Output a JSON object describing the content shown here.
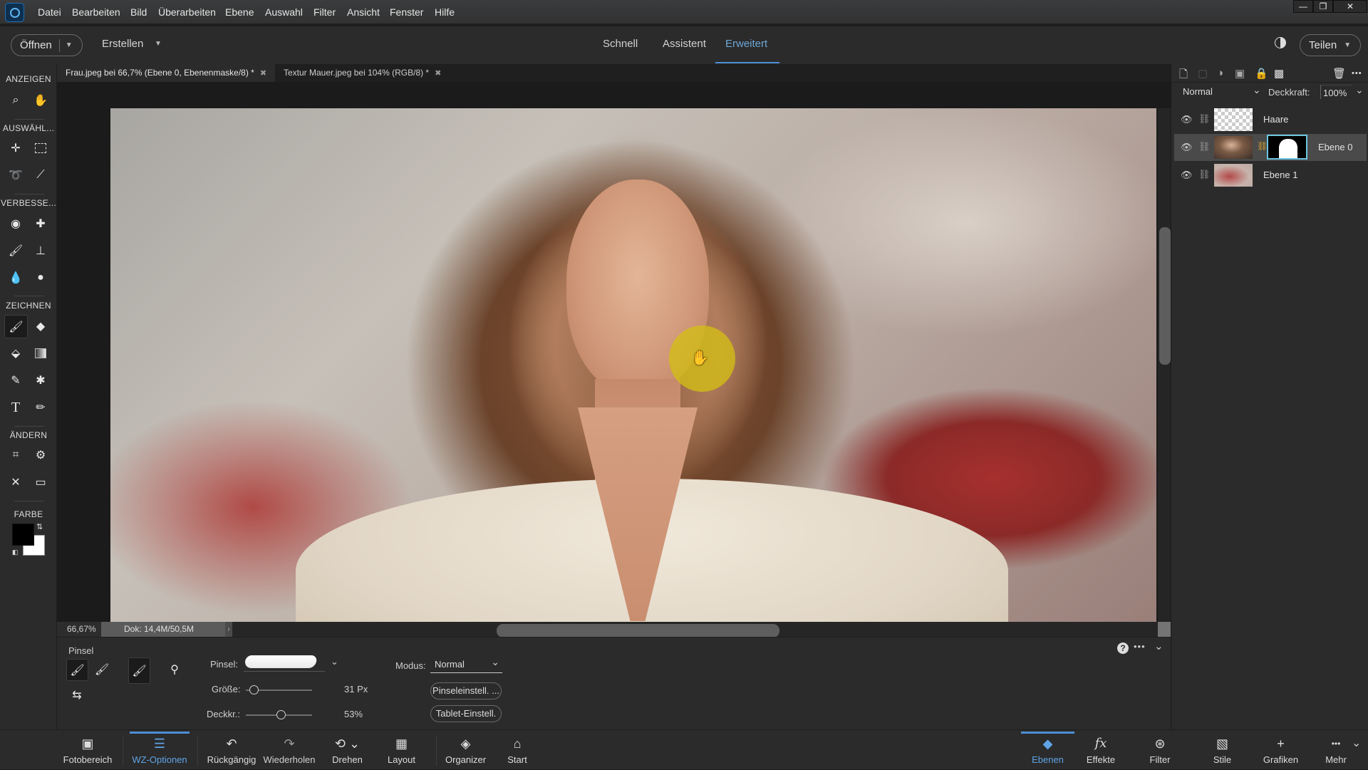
{
  "menubar": {
    "items": [
      "Datei",
      "Bearbeiten",
      "Bild",
      "Überarbeiten",
      "Ebene",
      "Auswahl",
      "Filter",
      "Ansicht",
      "Fenster",
      "Hilfe"
    ],
    "window_controls": {
      "minimize": "—",
      "restore": "❐",
      "close": "✕"
    }
  },
  "toolbar": {
    "open_label": "Öffnen",
    "create_label": "Erstellen",
    "modes": [
      {
        "label": "Schnell",
        "active": false
      },
      {
        "label": "Assistent",
        "active": false
      },
      {
        "label": "Erweitert",
        "active": true
      }
    ],
    "share_label": "Teilen",
    "theme_icon": "contrast-icon"
  },
  "document_tabs": [
    {
      "label": "Frau.jpeg bei 66,7% (Ebene 0, Ebenenmaske/8) *",
      "active": true
    },
    {
      "label": "Textur Mauer.jpeg bei 104% (RGB/8) *",
      "active": false
    }
  ],
  "tools": {
    "sections": [
      "ANZEIGEN",
      "AUSWÄHL...",
      "VERBESSE...",
      "ZEICHNEN",
      "ÄNDERN",
      "FARBE"
    ],
    "items": [
      {
        "name": "zoom-tool",
        "glyph": "🔍"
      },
      {
        "name": "hand-tool",
        "glyph": "✋"
      },
      {
        "name": "move-tool",
        "glyph": "✛"
      },
      {
        "name": "marquee-tool",
        "glyph": "⬚"
      },
      {
        "name": "lasso-tool",
        "glyph": "➰"
      },
      {
        "name": "magic-wand-tool",
        "glyph": "⁄"
      },
      {
        "name": "red-eye-tool",
        "glyph": "👁"
      },
      {
        "name": "spot-healing-tool",
        "glyph": "✚"
      },
      {
        "name": "smart-brush-tool",
        "glyph": "🖌"
      },
      {
        "name": "clone-stamp-tool",
        "glyph": "⊥"
      },
      {
        "name": "blur-tool",
        "glyph": "💧"
      },
      {
        "name": "sponge-tool",
        "glyph": "●"
      },
      {
        "name": "brush-tool",
        "glyph": "🖌",
        "active": true
      },
      {
        "name": "eraser-tool",
        "glyph": "◆"
      },
      {
        "name": "paint-bucket-tool",
        "glyph": "🪣"
      },
      {
        "name": "gradient-tool",
        "glyph": "▮"
      },
      {
        "name": "eyedropper-tool",
        "glyph": "✎"
      },
      {
        "name": "custom-shape-tool",
        "glyph": "✱"
      },
      {
        "name": "type-tool",
        "glyph": "T"
      },
      {
        "name": "pencil-tool",
        "glyph": "✏"
      },
      {
        "name": "crop-tool",
        "glyph": "⌗"
      },
      {
        "name": "recompose-tool",
        "glyph": "⚙"
      },
      {
        "name": "content-aware-move-tool",
        "glyph": "✕"
      },
      {
        "name": "straighten-tool",
        "glyph": "▭"
      }
    ],
    "foreground_color": "#000000",
    "background_color": "#ffffff"
  },
  "canvas": {
    "zoom": "66,67%",
    "doc_info": "Dok: 14,4M/50,5M"
  },
  "tool_options": {
    "tool_name": "Pinsel",
    "brush_label": "Pinsel:",
    "size_label": "Größe:",
    "size_value": "31 Px",
    "size_fraction": 0.12,
    "opacity_label": "Deckkr.:",
    "opacity_value": "53%",
    "opacity_fraction": 0.53,
    "mode_label": "Modus:",
    "mode_value": "Normal",
    "brush_settings_button": "Pinseleinstell. ...",
    "tablet_settings_button": "Tablet-Einstell. ..."
  },
  "layers_panel": {
    "blend_mode": "Normal",
    "opacity_label": "Deckkraft:",
    "opacity_value": "100%",
    "layers": [
      {
        "name": "Haare",
        "active": false,
        "has_mask": false
      },
      {
        "name": "Ebene 0",
        "active": true,
        "has_mask": true
      },
      {
        "name": "Ebene 1",
        "active": false,
        "has_mask": false
      }
    ]
  },
  "taskbar": {
    "left": [
      {
        "label": "Fotobereich",
        "icon": "photo-bin-icon",
        "glyph": "▣"
      },
      {
        "label": "WZ-Optionen",
        "icon": "tool-options-icon",
        "glyph": "☰",
        "active": true
      },
      {
        "label": "Rückgängig",
        "icon": "undo-icon",
        "glyph": "↶"
      },
      {
        "label": "Wiederholen",
        "icon": "redo-icon",
        "glyph": "↷"
      },
      {
        "label": "Drehen",
        "icon": "rotate-icon",
        "glyph": "⟲ ⌄"
      },
      {
        "label": "Layout",
        "icon": "layout-icon",
        "glyph": "▦"
      },
      {
        "label": "Organizer",
        "icon": "organizer-icon",
        "glyph": "◈"
      },
      {
        "label": "Start",
        "icon": "home-icon",
        "glyph": "⌂"
      }
    ],
    "right": [
      {
        "label": "Ebenen",
        "icon": "layers-icon",
        "glyph": "◆",
        "active": true
      },
      {
        "label": "Effekte",
        "icon": "effects-icon",
        "glyph": "fx"
      },
      {
        "label": "Filter",
        "icon": "filter-icon",
        "glyph": "⊛"
      },
      {
        "label": "Stile",
        "icon": "styles-icon",
        "glyph": "▧"
      },
      {
        "label": "Grafiken",
        "icon": "graphics-icon",
        "glyph": "+"
      },
      {
        "label": "Mehr",
        "icon": "more-icon",
        "glyph": "•••"
      }
    ]
  }
}
